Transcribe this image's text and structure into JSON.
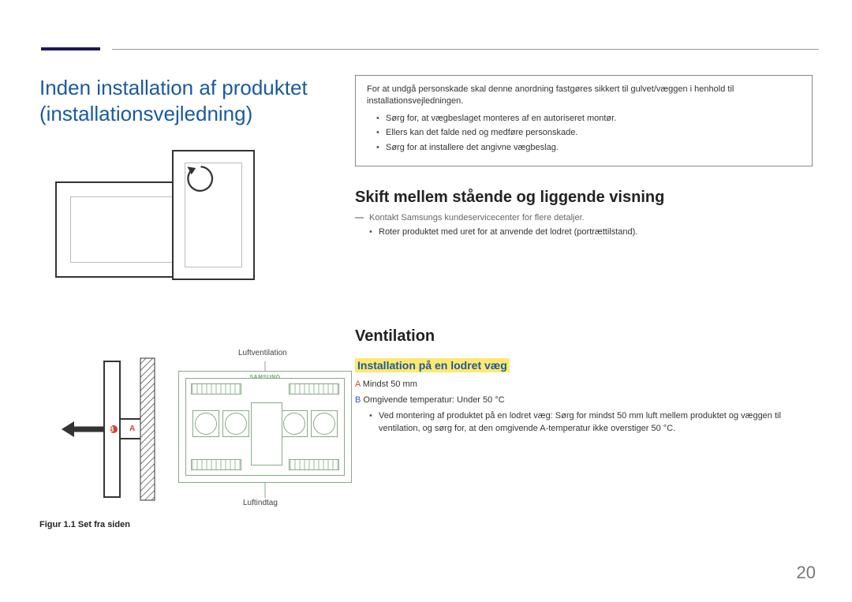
{
  "page_number": "20",
  "main_title_line1": "Inden installation af produktet",
  "main_title_line2": "(installationsvejledning)",
  "warn_lead": "For at undgå personskade skal denne anordning fastgøres sikkert til gulvet/væggen i henhold til installationsvejledningen.",
  "warn_b1": "Sørg for, at vægbeslaget monteres af en autoriseret montør.",
  "warn_b2": "Ellers kan det falde ned og medføre personskade.",
  "warn_b3": "Sørg for at installere det angivne vægbeslag.",
  "sec1_title": "Skift mellem stående og liggende visning",
  "sec1_note": "Kontakt Samsungs kundeservicecenter for flere detaljer.",
  "sec1_bullet": "Roter produktet med uret for at anvende det lodret (portrættilstand).",
  "sec2_title": "Ventilation",
  "sec2_sub": "Installation på en lodret væg",
  "vent_a_letter": "A",
  "vent_a_text": " Mindst 50 mm",
  "vent_b_letter": "B",
  "vent_b_text": " Omgivende temperatur: Under 50 °C",
  "vent_bullet_p1": "Ved montering af produktet på en lodret væg: Sørg for mindst 50 mm luft mellem produktet og væggen til ventilation, og sørg for, at den omgivende A-temperatur ikke overstiger 50 °C.",
  "label_top": "Luftventilation",
  "label_bottom": "Luftindtag",
  "brand": "SAMSUNG",
  "letter_a": "A",
  "letter_b": "B",
  "fig_caption": "Figur 1.1 Set fra siden"
}
